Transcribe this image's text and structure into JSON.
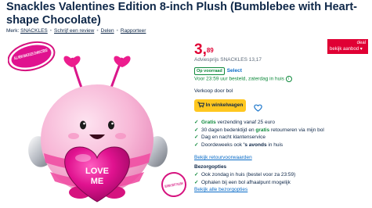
{
  "product": {
    "title": "Snackles Valentines Edition 8-inch Plush (Bumblebee with Heart-shape Chocolate)",
    "meta": {
      "brand_label": "Merk:",
      "brand": "SNACKLES",
      "review_link": "Schrijf een review",
      "share_link": "Delen",
      "report_link": "Rapporteer"
    },
    "image": {
      "top_sticker": "ALL NEW SNACKLES CHARACTERS!",
      "bottom_sticker": "SUPER SOFT PLUSH!",
      "heart_text_1": "LOVE",
      "heart_text_2": "ME"
    }
  },
  "buybox": {
    "price_whole": "3,",
    "price_cents": "89",
    "deal_label": "deal",
    "deal_sub": "bekijk aanbod",
    "deal_arrow": "▾",
    "advice_price": "Adviesprijs SNACKLES 13,17",
    "stock_badge": "Op voorraad",
    "select_label": "Select",
    "delivery": "Voor 23:59 uur besteld, zaterdag in huis",
    "info_symbol": "i",
    "seller": "Verkoop door bol",
    "cart_button": "In winkelwagen",
    "usps": [
      {
        "pre": "",
        "hl": "Gratis",
        "post": " verzending vanaf 25 euro"
      },
      {
        "pre": "30 dagen bedenktijd en ",
        "hl": "gratis",
        "post": " retourneren via mijn bol"
      },
      {
        "pre": "Dag en nacht klantenservice",
        "hl": "",
        "post": ""
      },
      {
        "pre": "Doordeweeks ook ",
        "hl": "'s avonds",
        "post": " in huis"
      }
    ],
    "retour_link": "Bekijk retourvoorwaarden",
    "options_title": "Bezorgopties",
    "options": [
      "Ook zondag in huis (bestel voor za 23:59)",
      "Ophalen bij een bol afhaalpunt mogelijk"
    ],
    "options_link": "Bekijk alle bezorgopties",
    "check_symbol": "✓"
  },
  "colors": {
    "accent_red": "#e00034",
    "cart_yellow": "#ffc71f",
    "link_blue": "#0a6cc8",
    "success_green": "#0f8a3c",
    "text_navy": "#0e2748"
  }
}
